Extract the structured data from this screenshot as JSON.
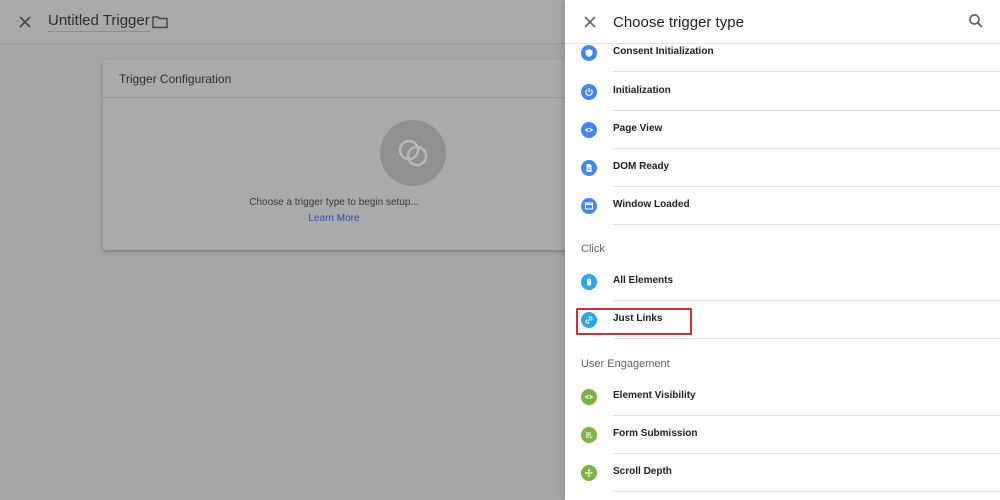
{
  "background": {
    "title": "Untitled Trigger",
    "card": {
      "header": "Trigger Configuration",
      "message": "Choose a trigger type to begin setup...",
      "link": "Learn More"
    }
  },
  "panel": {
    "title": "Choose trigger type",
    "items_top": [
      {
        "label": "Consent Initialization",
        "icon": "shield-icon",
        "color": "#4285f4"
      },
      {
        "label": "Initialization",
        "icon": "power-icon",
        "color": "#4285f4"
      },
      {
        "label": "Page View",
        "icon": "eye-icon",
        "color": "#4285f4"
      },
      {
        "label": "DOM Ready",
        "icon": "document-icon",
        "color": "#4285f4"
      },
      {
        "label": "Window Loaded",
        "icon": "window-icon",
        "color": "#4285f4"
      }
    ],
    "section_click": "Click",
    "items_click": [
      {
        "label": "All Elements",
        "icon": "mouse-icon",
        "color": "#2ba6e8"
      },
      {
        "label": "Just Links",
        "icon": "link-icon",
        "color": "#2ba6e8"
      }
    ],
    "section_engagement": "User Engagement",
    "items_engagement": [
      {
        "label": "Element Visibility",
        "icon": "eye-icon",
        "color": "#7cb342"
      },
      {
        "label": "Form Submission",
        "icon": "form-icon",
        "color": "#7cb342"
      },
      {
        "label": "Scroll Depth",
        "icon": "move-icon",
        "color": "#7cb342"
      }
    ]
  },
  "colors": {
    "highlight": "#d32f2f"
  }
}
